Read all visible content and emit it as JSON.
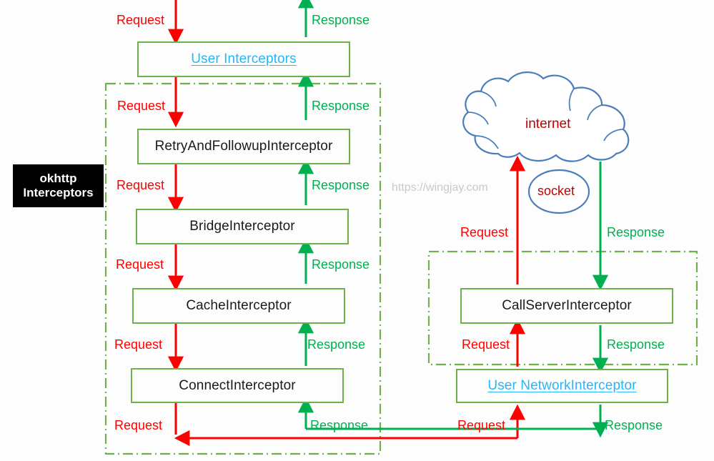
{
  "diagram": {
    "title": "okhttp Interceptors chain",
    "watermark": "https://wingjay.com",
    "colors": {
      "request": "#FF0000",
      "response": "#00B050",
      "box_border": "#6FB04A",
      "user_text": "#29B6F6",
      "cloud_stroke": "#4A7EBB",
      "cloud_text": "#C00000",
      "container_dash": "#6FB04A",
      "tag_background": "#000000",
      "tag_text": "#FFFFFF",
      "watermark_text": "#C9C9C9"
    }
  },
  "tag": {
    "line1": "okhttp",
    "line2": "Interceptors"
  },
  "boxes": [
    {
      "id": "user-interceptors",
      "label": "User    Interceptors",
      "style": "user"
    },
    {
      "id": "retry-and-followup",
      "label": "RetryAndFollowupInterceptor",
      "style": "plain"
    },
    {
      "id": "bridge-interceptor",
      "label": "BridgeInterceptor",
      "style": "plain"
    },
    {
      "id": "cache-interceptor",
      "label": "CacheInterceptor",
      "style": "plain"
    },
    {
      "id": "connect-interceptor",
      "label": "ConnectInterceptor",
      "style": "plain"
    },
    {
      "id": "call-server-interceptor",
      "label": "CallServerInterceptor",
      "style": "plain"
    },
    {
      "id": "user-network-interceptor",
      "label": "User  NetworkInterceptor",
      "style": "user"
    }
  ],
  "cloud": {
    "label": "internet"
  },
  "socket": {
    "label": "socket"
  },
  "flow_labels": {
    "request": "Request",
    "response": "Response",
    "left": [
      {
        "id": "req-top",
        "text": "Request"
      },
      {
        "id": "res-top",
        "text": "Response"
      },
      {
        "id": "req-retry",
        "text": "Request"
      },
      {
        "id": "res-retry",
        "text": "Response"
      },
      {
        "id": "req-bridge",
        "text": "Request"
      },
      {
        "id": "res-bridge",
        "text": "Response"
      },
      {
        "id": "req-cache",
        "text": "Request"
      },
      {
        "id": "res-cache",
        "text": "Response"
      },
      {
        "id": "req-connect",
        "text": "Request"
      },
      {
        "id": "res-connect",
        "text": "Response"
      },
      {
        "id": "req-bottom-left",
        "text": "Request"
      },
      {
        "id": "res-bottom-left",
        "text": "Response"
      }
    ],
    "right": [
      {
        "id": "req-internet",
        "text": "Request"
      },
      {
        "id": "res-internet",
        "text": "Response"
      },
      {
        "id": "req-callserver",
        "text": "Request"
      },
      {
        "id": "res-callserver",
        "text": "Response"
      },
      {
        "id": "req-bottom-right",
        "text": "Request"
      },
      {
        "id": "res-bottom-right",
        "text": "Response"
      }
    ]
  }
}
